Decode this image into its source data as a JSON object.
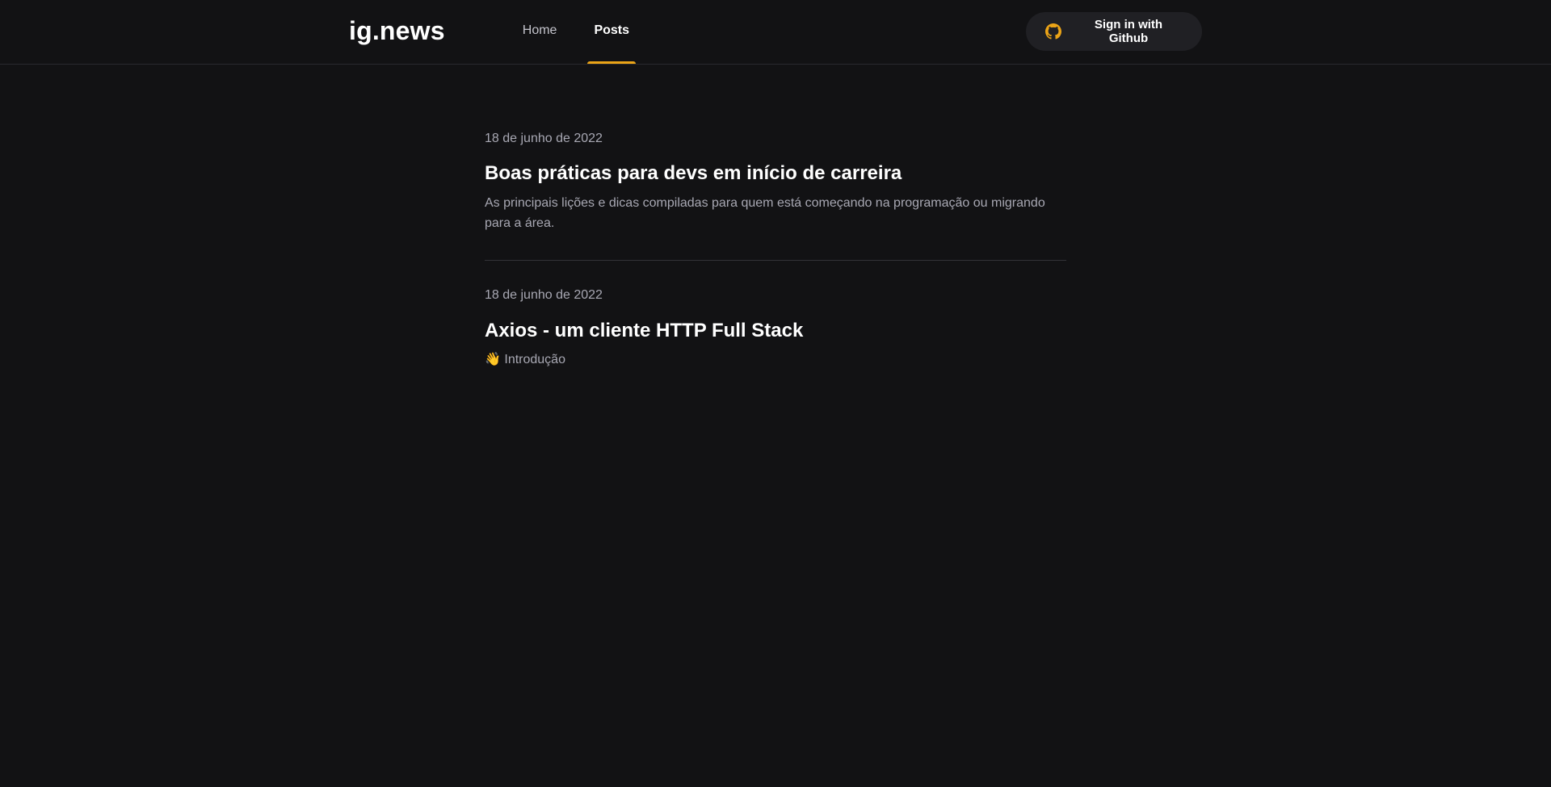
{
  "header": {
    "logo": "ig.news",
    "nav": [
      {
        "label": "Home",
        "active": false
      },
      {
        "label": "Posts",
        "active": true
      }
    ],
    "signin_label": "Sign in with Github",
    "github_icon": "github-icon"
  },
  "posts": [
    {
      "date": "18 de junho de 2022",
      "title": "Boas práticas para devs em início de carreira",
      "excerpt": "As principais lições e dicas compiladas para quem está começando na programação ou migrando para a área."
    },
    {
      "date": "18 de junho de 2022",
      "title": "Axios - um cliente HTTP Full Stack",
      "excerpt": "👋 Introdução"
    }
  ],
  "colors": {
    "background": "#121214",
    "accent": "#eba417",
    "button_bg": "#202024",
    "muted_text": "#a8a8b3",
    "divider": "#323238"
  }
}
